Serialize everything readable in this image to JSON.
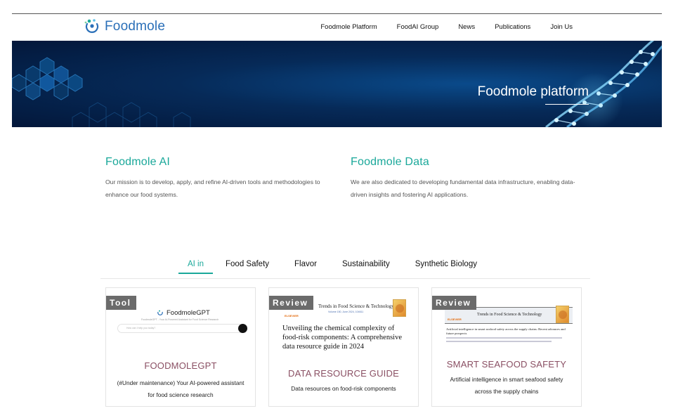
{
  "brand": {
    "name": "Foodmole",
    "color": "#2a6fb8"
  },
  "nav": [
    {
      "label": "Foodmole Platform"
    },
    {
      "label": "FoodAI Group"
    },
    {
      "label": "News"
    },
    {
      "label": "Publications"
    },
    {
      "label": "Join Us"
    }
  ],
  "hero": {
    "title": "Foodmole platform"
  },
  "mission": {
    "ai": {
      "heading": "Foodmole AI",
      "text": "Our mission is to develop, apply, and refine AI-driven tools and methodologies to enhance our food systems."
    },
    "data": {
      "heading": "Foodmole Data",
      "text": "We are also dedicated to developing fundamental data infrastructure, enabling data-driven insights and fostering AI applications."
    }
  },
  "accent_color": "#1aa89a",
  "tabs": [
    {
      "label": "AI in",
      "active": true
    },
    {
      "label": "Food Safety",
      "active": false
    },
    {
      "label": "Flavor",
      "active": false
    },
    {
      "label": "Sustainability",
      "active": false
    },
    {
      "label": "Synthetic Biology",
      "active": false
    }
  ],
  "cards": [
    {
      "badge": "Tool",
      "preview": {
        "app_name": "FoodmoleGPT",
        "subtitle": "FoodmoleGPT - Your AI-Powered Assistant for Food Science Research",
        "input_placeholder": "How can I help you today?"
      },
      "title": "FOODMOLEGPT",
      "description": "(#Under maintenance) Your AI-powered assistant for food science research"
    },
    {
      "badge": "Review",
      "preview": {
        "journal": "Trends in Food Science & Technology",
        "meta": "Volume 150, June 2024, 104611",
        "publisher": "ELSEVIER",
        "paper_title": "Unveiling the chemical complexity of food-risk components: A comprehensive data resource guide in 2024"
      },
      "title": "DATA RESOURCE GUIDE",
      "description": "Data resources on food-risk components"
    },
    {
      "badge": "Review",
      "preview": {
        "journal": "Trends in Food Science & Technology",
        "publisher": "ELSEVIER",
        "paper_title": "Artificial intelligence in smart seafood safety across the supply chains: Recent advances and future prospects"
      },
      "title": "SMART SEAFOOD SAFETY",
      "description": "Artificial intelligence in smart seafood safety across the supply chains"
    }
  ],
  "icons": [
    "foodmole-logo-icon",
    "dna-helix-graphic",
    "send-icon"
  ]
}
